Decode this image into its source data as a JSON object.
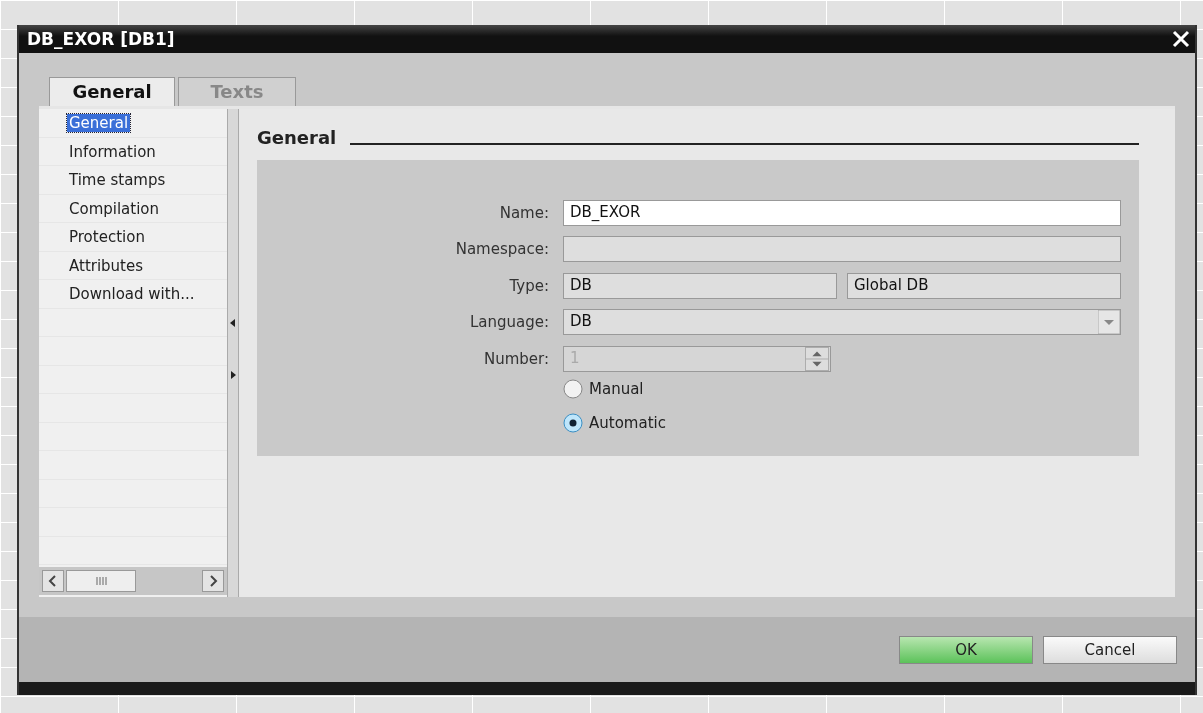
{
  "window": {
    "title": "DB_EXOR [DB1]"
  },
  "tabs": [
    {
      "label": "General",
      "selected": true
    },
    {
      "label": "Texts",
      "selected": false
    }
  ],
  "nav": {
    "items": [
      {
        "label": "General",
        "selected": true
      },
      {
        "label": "Information",
        "selected": false
      },
      {
        "label": "Time stamps",
        "selected": false
      },
      {
        "label": "Compilation",
        "selected": false
      },
      {
        "label": "Protection",
        "selected": false
      },
      {
        "label": "Attributes",
        "selected": false
      },
      {
        "label": "Download with...",
        "selected": false
      }
    ]
  },
  "section": {
    "title": "General",
    "fields": [
      {
        "kind": "text",
        "label": "Name:",
        "values": [
          "DB_EXOR"
        ],
        "readonly": false
      },
      {
        "kind": "text",
        "label": "Namespace:",
        "readonly": true
      },
      {
        "kind": "text",
        "label": "Type:",
        "values": [
          "DB",
          "Global DB"
        ],
        "readonly": true
      },
      {
        "kind": "dropdown",
        "label": "Language:",
        "values": [
          "DB"
        ],
        "readonly": true
      },
      {
        "kind": "spinner",
        "label": "Number:",
        "values": [
          "1"
        ],
        "disabled": true
      },
      {
        "kind": "radio",
        "options": [
          {
            "label": "Manual",
            "selected": false
          },
          {
            "label": "Automatic",
            "selected": true
          }
        ]
      }
    ]
  },
  "buttons": [
    {
      "label": "OK",
      "default": true
    },
    {
      "label": "Cancel",
      "default": false
    }
  ]
}
